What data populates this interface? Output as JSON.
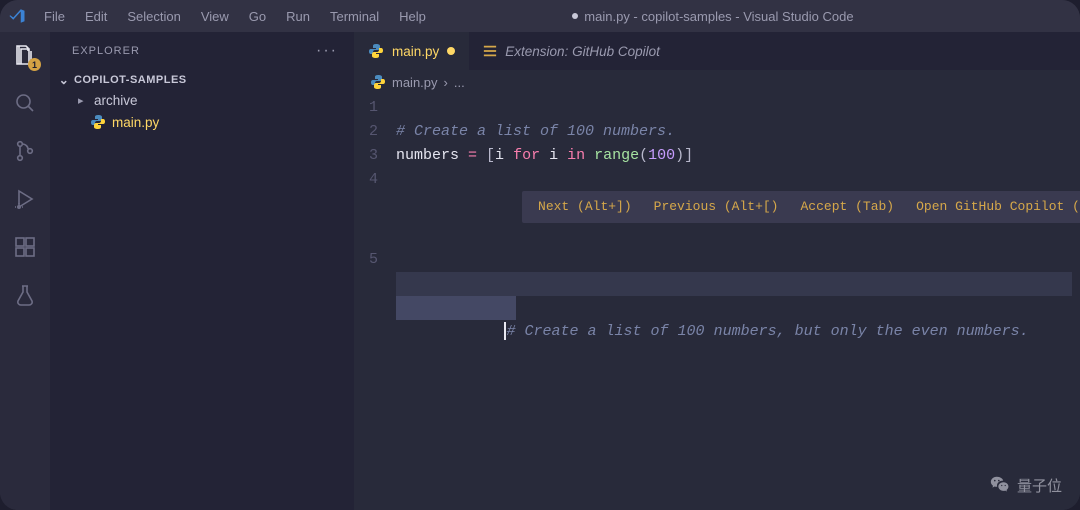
{
  "title": {
    "dirty": true,
    "text": "main.py - copilot-samples - Visual Studio Code"
  },
  "menu": [
    "File",
    "Edit",
    "Selection",
    "View",
    "Go",
    "Run",
    "Terminal",
    "Help"
  ],
  "activitybar": {
    "explorer_badge": "1"
  },
  "sidebar": {
    "header": "EXPLORER",
    "more": "···",
    "section": "COPILOT-SAMPLES",
    "items": {
      "folder": "archive",
      "file": "main.py"
    }
  },
  "tabs": {
    "main": {
      "label": "main.py"
    },
    "ext": {
      "label": "Extension: GitHub Copilot"
    }
  },
  "breadcrumb": {
    "file": "main.py",
    "sep": "›",
    "rest": "..."
  },
  "editor": {
    "gutter": [
      "1",
      "2",
      "3",
      "4",
      "5"
    ],
    "l2_comment": "# Create a list of 100 numbers.",
    "l3": {
      "numbers": "numbers",
      "eq": " = ",
      "lb": "[",
      "i1": "i",
      "for": " for ",
      "i2": "i",
      "in": " in ",
      "range": "range",
      "lp": "(",
      "n": "100",
      "rp": ")",
      "rb": "]"
    },
    "l5_comment": "# Create a list of 100 numbers, but only the even numbers."
  },
  "copilot": {
    "next": "Next (Alt+])",
    "prev": "Previous (Alt+[)",
    "accept": "Accept (Tab)",
    "open": "Open GitHub Copilot (Ctrl+Enter)"
  },
  "watermark": "量子位"
}
